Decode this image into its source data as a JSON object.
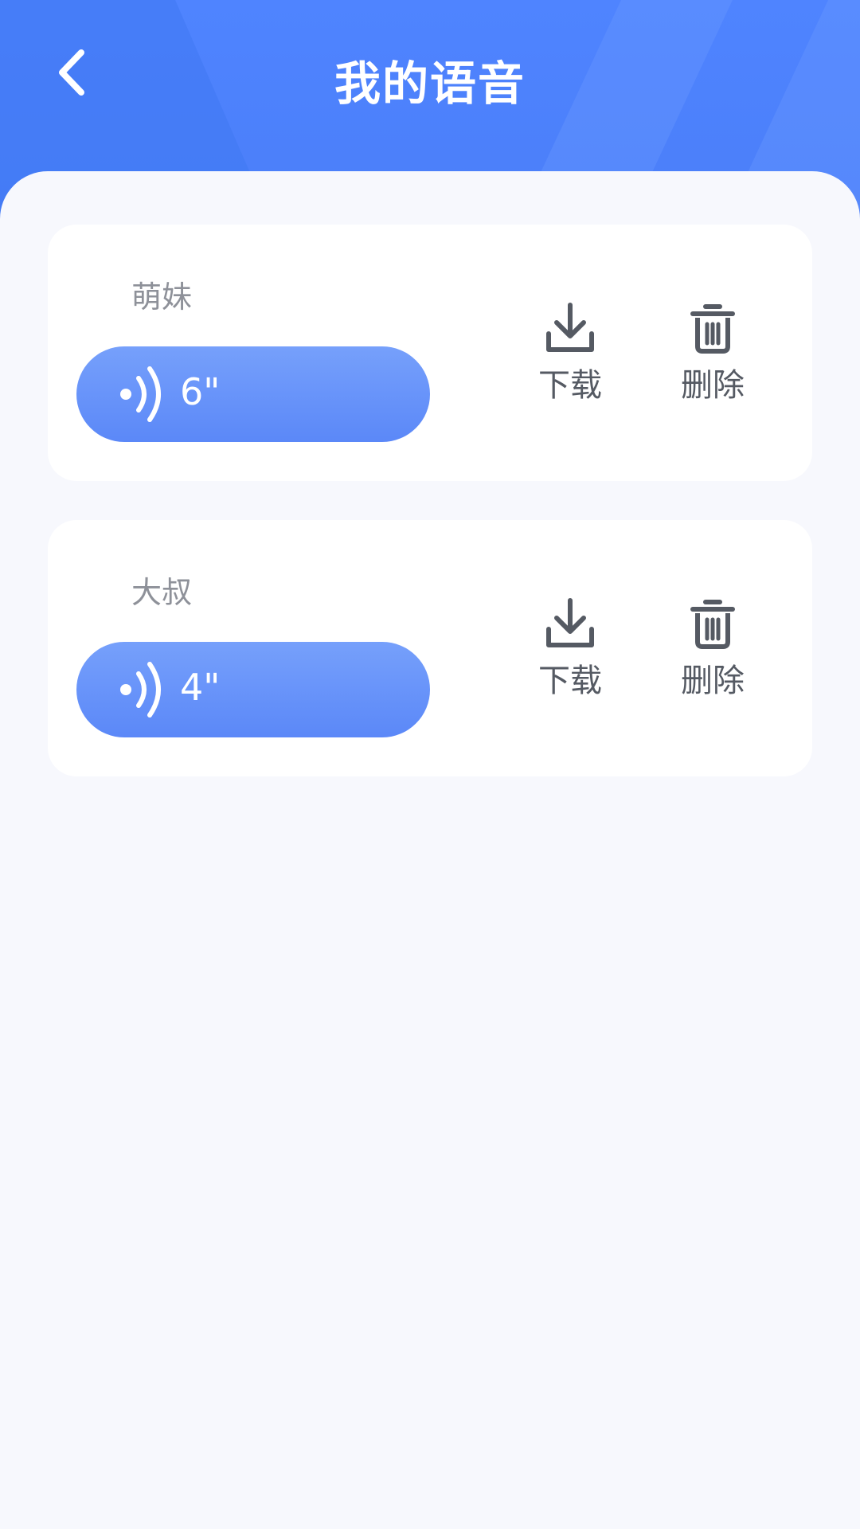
{
  "header": {
    "title": "我的语音",
    "back_icon": "chevron-left-icon",
    "color": "#4f84ff"
  },
  "voices": [
    {
      "name": "萌妹",
      "duration": "6\"",
      "download_label": "下载",
      "delete_label": "删除"
    },
    {
      "name": "大叔",
      "duration": "4\"",
      "download_label": "下载",
      "delete_label": "删除"
    }
  ],
  "icons": {
    "voice": "sound-wave-icon",
    "download": "download-icon",
    "delete": "trash-icon"
  }
}
